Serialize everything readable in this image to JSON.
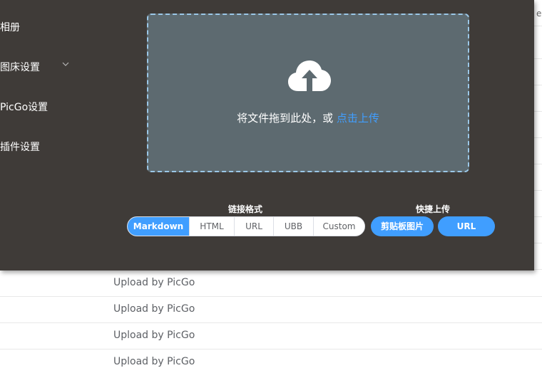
{
  "sidebar": {
    "items": [
      {
        "label": "相册"
      },
      {
        "label": "图床设置"
      },
      {
        "label": "PicGo设置"
      },
      {
        "label": "插件设置"
      }
    ]
  },
  "upload": {
    "drop_text": "将文件拖到此处，或",
    "click_text": "点击上传"
  },
  "link_format": {
    "label": "链接格式",
    "options": [
      "Markdown",
      "HTML",
      "URL",
      "UBB",
      "Custom"
    ],
    "selected": "Markdown"
  },
  "quick_upload": {
    "label": "快捷上传",
    "clipboard_label": "剪贴板图片",
    "url_label": "URL"
  },
  "background": {
    "header_fragment": "ea",
    "rows": [
      "Upload by PicGo",
      "Upload by PicGo",
      "Upload by PicGo",
      "Upload by PicGo"
    ]
  },
  "colors": {
    "accent": "#409eff",
    "window_bg": "#3f3b38",
    "dropzone_bg": "#5d6a70",
    "dropzone_border": "#9bc7e7"
  },
  "icons": {
    "upload": "cloud-upload-icon",
    "submenu": "chevron-down-icon"
  }
}
